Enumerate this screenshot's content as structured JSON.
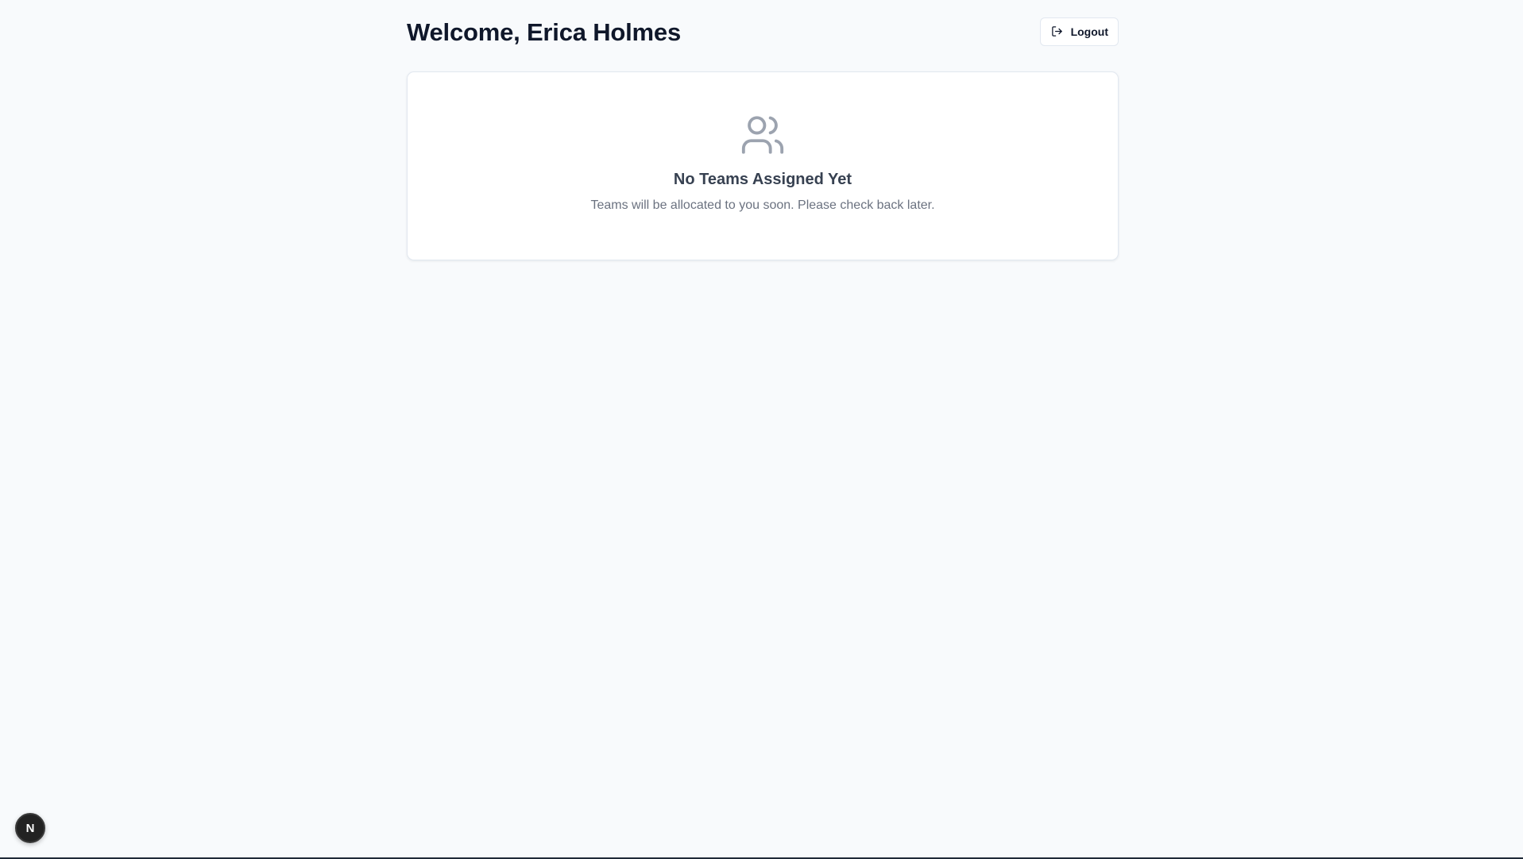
{
  "header": {
    "title": "Welcome, Erica Holmes",
    "logout_label": "Logout",
    "logout_icon": "logout-icon"
  },
  "empty_state": {
    "icon": "users-icon",
    "title": "No Teams Assigned Yet",
    "message": "Teams will be allocated to you soon. Please check back later."
  },
  "dev_badge": {
    "letter": "N",
    "icon": "nextjs-icon"
  },
  "colors": {
    "background": "#f8fafc",
    "card": "#ffffff",
    "border": "#e2e8f0",
    "title": "#0f172a",
    "muted_icon": "#9ca3af",
    "muted_text": "#6b7280"
  }
}
